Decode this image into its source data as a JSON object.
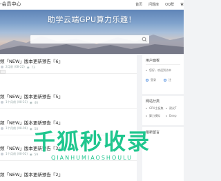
{
  "header": {
    "site_title": "-会员中心",
    "nav": [
      "首页",
      "问题库",
      "QQ群",
      "官"
    ]
  },
  "hero": {
    "slogan": "助学云端GPU算力乐趣！",
    "search_placeholder": ""
  },
  "posts": [
    {
      "title": "频「NEW」版本更新预告『6』",
      "date": "2月前 (08-22)",
      "views": "73"
    },
    {
      "title": "频「NEW」版本更新预告『5』",
      "date": "1个月前 (08-23)",
      "views": "46"
    },
    {
      "title": "频「NEW」版本更新预告『4』",
      "date": "1个月前 (08-06)",
      "views": "58"
    },
    {
      "title": "频「NEW」版本更新预告『3』",
      "date": "1个月前 (08-02)",
      "views": "59"
    },
    {
      "title": "频「NEW」版本更新预告『2』",
      "date": "",
      "views": ""
    }
  ],
  "sidebar": {
    "login_card": {
      "title": "用户面板",
      "welcome": "您好，欢迎到访本",
      "links": [
        "登录",
        "注"
      ]
    },
    "category_card": {
      "title": "网站分类",
      "items": [
        "GPU主板集",
        "建议T",
        "算力模拟",
        "Deep"
      ]
    },
    "latest_card": {
      "title": "最新留言"
    }
  },
  "watermark": {
    "main": "千狐秒收录",
    "sub": "QIANHUMIAOSHOULU"
  },
  "colors": {
    "accent": "#4c8be0",
    "watermark": "#1fc68e"
  }
}
